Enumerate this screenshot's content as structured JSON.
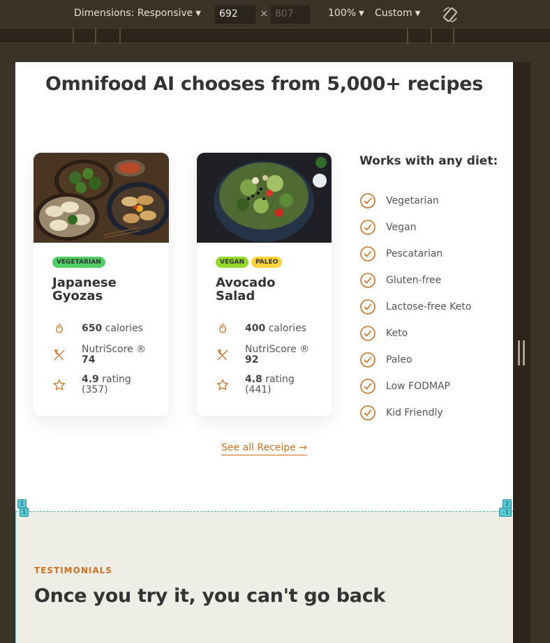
{
  "devtools": {
    "dimensions_label": "Dimensions: Responsive",
    "width_value": "692",
    "times": "×",
    "height_value": "807",
    "zoom": "100%",
    "throttle": "Custom"
  },
  "page": {
    "heading": "Omnifood AI chooses from 5,000+ recipes",
    "cards": [
      {
        "tags": [
          {
            "label": "VEGETARIAN",
            "color": "#51cf66"
          }
        ],
        "title": "Japanese Gyozas",
        "calories_value": "650",
        "calories_unit": "calories",
        "nutri_label": "NutriScore ®",
        "nutri_value": "74",
        "rating_value": "4.9",
        "rating_unit": "rating",
        "rating_count": "(357)"
      },
      {
        "tags": [
          {
            "label": "VEGAN",
            "color": "#94d82d"
          },
          {
            "label": "PALEO",
            "color": "#ffd43b"
          }
        ],
        "title": "Avocado Salad",
        "calories_value": "400",
        "calories_unit": "calories",
        "nutri_label": "NutriScore ®",
        "nutri_value": "92",
        "rating_value": "4.8",
        "rating_unit": "rating",
        "rating_count": "(441)"
      }
    ],
    "diet_title": "Works with any diet:",
    "diets": [
      "Vegetarian",
      "Vegan",
      "Pescatarian",
      "Gluten-free",
      "Lactose-free Keto",
      "Keto",
      "Paleo",
      "Low FODMAP",
      "Kid Friendly"
    ],
    "see_all": "See all Receipe →",
    "testimonials": {
      "subheading": "TESTIMONIALS",
      "heading": "Once you try it, you can't go back"
    },
    "grid_badges": [
      "1",
      "1",
      "2",
      "-1"
    ]
  },
  "colors": {
    "accent": "#cf711f",
    "testimonials_bg": "#eeede6",
    "devtools_bg": "#3a3127"
  }
}
